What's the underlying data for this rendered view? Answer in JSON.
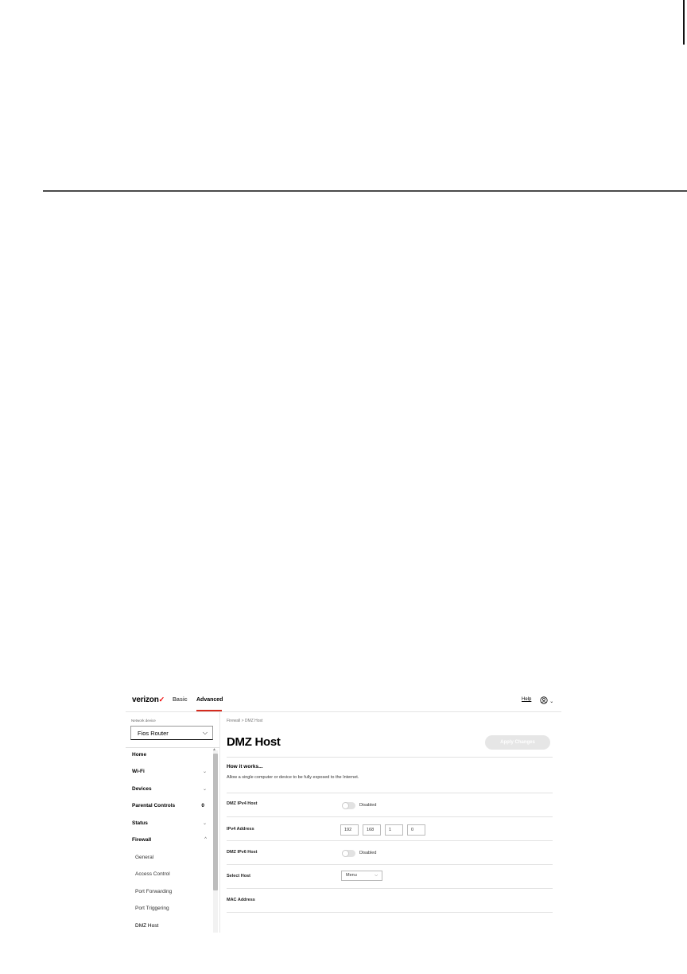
{
  "app": {
    "logo_text": "verizon",
    "logo_check": "✓",
    "tabs": {
      "basic": "Basic",
      "advanced": "Advanced"
    },
    "help": "Help",
    "user_icon": "user-circle-icon"
  },
  "sidebar": {
    "network_device_label": "Network device",
    "network_device_value": "Fios Router",
    "items": [
      {
        "label": "Home"
      },
      {
        "label": "Wi-Fi",
        "chevron": "⌄"
      },
      {
        "label": "Devices",
        "chevron": "⌄"
      },
      {
        "label": "Parental Controls",
        "badge": "0"
      },
      {
        "label": "Status",
        "chevron": "⌄"
      },
      {
        "label": "Firewall",
        "chevron": "^"
      }
    ],
    "subitems": [
      "General",
      "Access Control",
      "Port Forwarding",
      "Port Triggering",
      "DMZ Host"
    ]
  },
  "main": {
    "breadcrumb": "Firewall  >  DMZ Host",
    "title": "DMZ Host",
    "apply_button": "Apply Changes",
    "how_it_works": "How it works...",
    "description": "Allow a single computer or device to be fully exposed to the Internet.",
    "rows": {
      "ipv4_host": "DMZ IPv4 Host",
      "ipv4_host_state": "Disabled",
      "ipv4_address": "IPv4 Address",
      "ip_octets": [
        "192",
        "168",
        "1",
        "0"
      ],
      "ipv6_host": "DMZ IPv6 Host",
      "ipv6_host_state": "Disabled",
      "select_host": "Select Host",
      "select_host_value": "Menu",
      "mac_address": "MAC Address"
    }
  },
  "colors": {
    "accent": "#d52b1e"
  }
}
